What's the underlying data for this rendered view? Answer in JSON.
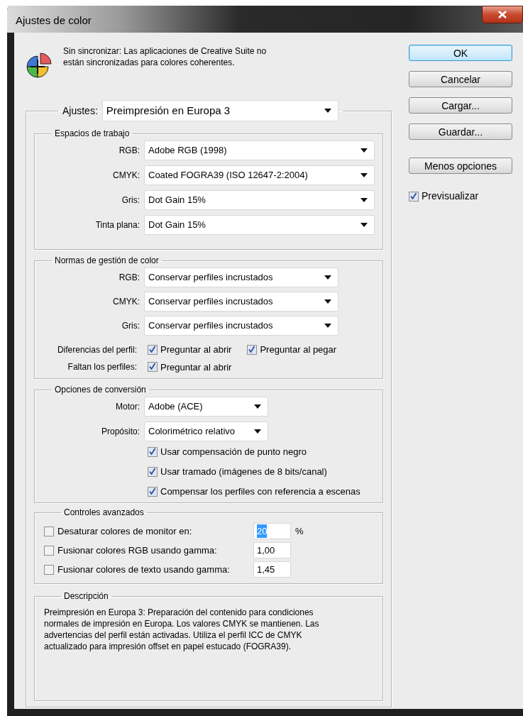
{
  "window": {
    "title": "Ajustes de color"
  },
  "sync_message": "Sin sincronizar: Las aplicaciones de Creative Suite no están sincronizadas para colores coherentes.",
  "settings": {
    "label": "Ajustes:",
    "value": "Preimpresión en Europa 3"
  },
  "working_spaces": {
    "title": "Espacios de trabajo",
    "fields": [
      {
        "label": "RGB:",
        "value": "Adobe RGB (1998)"
      },
      {
        "label": "CMYK:",
        "value": "Coated FOGRA39 (ISO 12647-2:2004)"
      },
      {
        "label": "Gris:",
        "value": "Dot Gain 15%"
      },
      {
        "label": "Tinta plana:",
        "value": "Dot Gain 15%"
      }
    ]
  },
  "color_policies": {
    "title": "Normas de gestión de color",
    "fields": [
      {
        "label": "RGB:",
        "value": "Conservar perfiles incrustados"
      },
      {
        "label": "CMYK:",
        "value": "Conservar perfiles incrustados"
      },
      {
        "label": "Gris:",
        "value": "Conservar perfiles incrustados"
      }
    ],
    "check_rows": [
      {
        "label": "Diferencias del perfil:",
        "options": [
          {
            "label": "Preguntar al abrir",
            "checked": true
          },
          {
            "label": "Preguntar al pegar",
            "checked": true
          }
        ]
      },
      {
        "label": "Faltan los perfiles:",
        "options": [
          {
            "label": "Preguntar al abrir",
            "checked": true
          }
        ]
      }
    ]
  },
  "conversion": {
    "title": "Opciones de conversión",
    "fields": [
      {
        "label": "Motor:",
        "value": "Adobe (ACE)"
      },
      {
        "label": "Propósito:",
        "value": "Colorimétrico relativo"
      }
    ],
    "options": [
      {
        "label": "Usar compensación de punto negro",
        "checked": true
      },
      {
        "label": "Usar tramado (imágenes de 8 bits/canal)",
        "checked": true
      },
      {
        "label": "Compensar los perfiles con referencia a escenas",
        "checked": true
      }
    ]
  },
  "advanced": {
    "title": "Controles avanzados",
    "rows": [
      {
        "label": "Desaturar colores de monitor en:",
        "checked": false,
        "value": "20",
        "highlighted": true,
        "unit": "%"
      },
      {
        "label": "Fusionar colores RGB usando gamma:",
        "checked": false,
        "value": "1,00",
        "highlighted": false
      },
      {
        "label": "Fusionar colores de texto usando gamma:",
        "checked": false,
        "value": "1,45",
        "highlighted": false
      }
    ]
  },
  "description": {
    "title": "Descripción",
    "text": "Preimpresión en Europa 3: Preparación del contenido para condiciones normales de impresión en Europa. Los valores CMYK se mantienen. Las advertencias del perfil están activadas. Utiliza el perfil ICC de CMYK actualizado para impresión offset en papel estucado (FOGRA39)."
  },
  "buttons": [
    {
      "label": "OK",
      "default": true
    },
    {
      "label": "Cancelar",
      "default": false
    },
    {
      "label": "Cargar...",
      "default": false
    },
    {
      "label": "Guardar...",
      "default": false
    }
  ],
  "options_button": {
    "label": "Menos opciones"
  },
  "preview": {
    "label": "Previsualizar",
    "checked": true
  }
}
